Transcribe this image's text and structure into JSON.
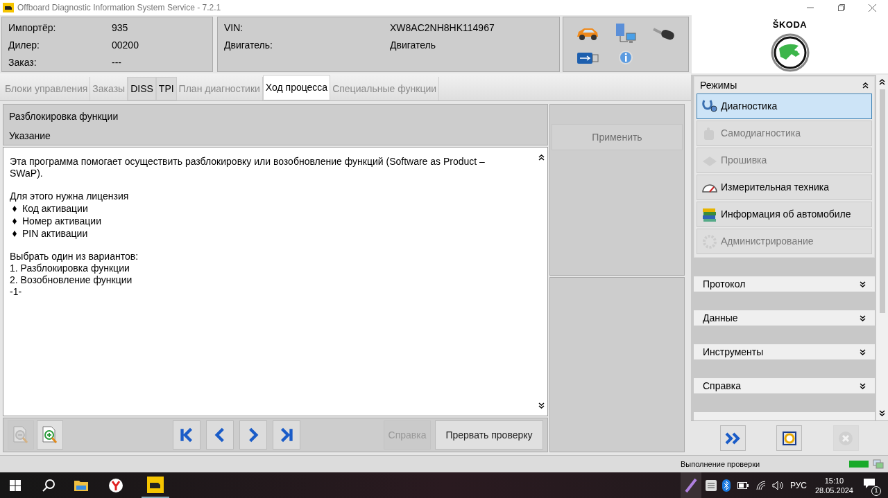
{
  "window": {
    "title": "Offboard Diagnostic Information System Service - 7.2.1"
  },
  "info": [
    {
      "label": "Импортёр:",
      "value": "935"
    },
    {
      "label": "Дилер:",
      "value": "00200"
    },
    {
      "label": "Заказ:",
      "value": "---"
    }
  ],
  "vehicle": [
    {
      "label": "VIN:",
      "value": "XW8AC2NH8HK114967"
    },
    {
      "label": "Двигатель:",
      "value": "Двигатель"
    }
  ],
  "brand": {
    "name": "ŠKODA"
  },
  "tabs": [
    {
      "label": "Блоки управления",
      "selected": false,
      "disabled": true
    },
    {
      "label": "Заказы",
      "selected": false,
      "disabled": true
    },
    {
      "label": "DISS",
      "selected": false,
      "disabled": false
    },
    {
      "label": "TPI",
      "selected": false,
      "disabled": false
    },
    {
      "label": "План диагностики",
      "selected": false,
      "disabled": true
    },
    {
      "label": "Ход процесса",
      "selected": true,
      "disabled": false
    },
    {
      "label": "Специальные функции",
      "selected": false,
      "disabled": true
    }
  ],
  "panel": {
    "title": "Разблокировка функции",
    "subtitle": "Указание",
    "lines": [
      {
        "kind": "text",
        "text": "Эта программа помогает осуществить разблокировку или возобновление функций (Software as Product – SWaP)."
      },
      {
        "kind": "gap"
      },
      {
        "kind": "text",
        "text": "Для этого нужна лицензия"
      },
      {
        "kind": "bullet",
        "text": "Код активации"
      },
      {
        "kind": "bullet",
        "text": "Номер активации"
      },
      {
        "kind": "bullet",
        "text": "PIN активации"
      },
      {
        "kind": "gap"
      },
      {
        "kind": "text",
        "text": "Выбрать один из вариантов:"
      },
      {
        "kind": "text",
        "text": "1. Разблокировка функции"
      },
      {
        "kind": "text",
        "text": "2. Возобновление функции"
      },
      {
        "kind": "text",
        "text": "-1-"
      }
    ]
  },
  "apply_button": {
    "label": "Применить",
    "disabled": true
  },
  "zoom_buttons": [
    {
      "disabled": true
    },
    {
      "disabled": false
    }
  ],
  "help_button": {
    "label": "Справка",
    "disabled": true
  },
  "abort_button": {
    "label": "Прервать проверку",
    "disabled": false
  },
  "sidebar": {
    "modes": {
      "title": "Режимы",
      "expanded": true,
      "items": [
        {
          "label": "Диагностика",
          "selected": true,
          "disabled": false
        },
        {
          "label": "Самодиагностика",
          "selected": false,
          "disabled": true
        },
        {
          "label": "Прошивка",
          "selected": false,
          "disabled": true
        },
        {
          "label": "Измерительная техника",
          "selected": false,
          "disabled": false
        },
        {
          "label": "Информация об автомобиле",
          "selected": false,
          "disabled": false
        },
        {
          "label": "Администрирование",
          "selected": false,
          "disabled": true
        }
      ]
    },
    "sections": [
      {
        "title": "Протокол",
        "expanded": false
      },
      {
        "title": "Данные",
        "expanded": false
      },
      {
        "title": "Инструменты",
        "expanded": false
      },
      {
        "title": "Справка",
        "expanded": false
      }
    ],
    "buttons": [
      {
        "disabled": false
      },
      {
        "disabled": false
      },
      {
        "disabled": true
      }
    ]
  },
  "status_bar": {
    "text": "Выполнение проверки"
  },
  "taskbar": {
    "language": "РУС",
    "time": "15:10",
    "date": "28.05.2024",
    "notifications": "1"
  }
}
